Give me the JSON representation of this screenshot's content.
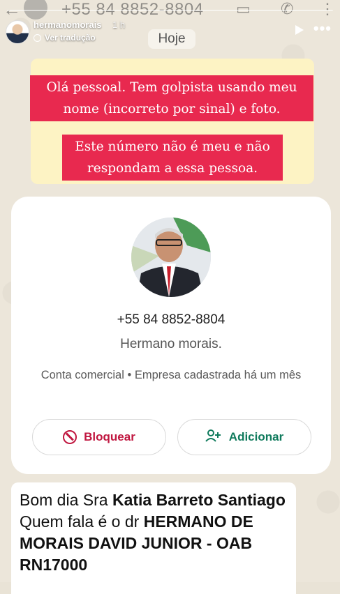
{
  "topbar": {
    "phone": "+55 84 8852-8804"
  },
  "story": {
    "username": "hermanomorais",
    "time": "1 h",
    "translate_label": "Ver tradução"
  },
  "chat": {
    "date_chip": "Hoje"
  },
  "overlay": {
    "line1": "Olá pessoal. Tem golpista usando meu nome (incorreto por sinal) e foto.",
    "line2": "Este número não é meu e não respondam a essa pessoa."
  },
  "contact": {
    "phone": "+55 84 8852-8804",
    "name": "Hermano morais.",
    "meta": "Conta comercial • Empresa cadastrada há um mês",
    "block_label": "Bloquear",
    "add_label": "Adicionar"
  },
  "message": {
    "greeting": "Bom dia  Sra ",
    "recipient": "Katia Barreto Santiago",
    "intro": "Quem fala é o dr ",
    "sender": "HERMANO DE MORAIS DAVID JUNIOR - OAB RN17000"
  },
  "colors": {
    "overlay_red": "#e8294f",
    "block_red": "#c0163f",
    "add_green": "#0f7a5c"
  }
}
